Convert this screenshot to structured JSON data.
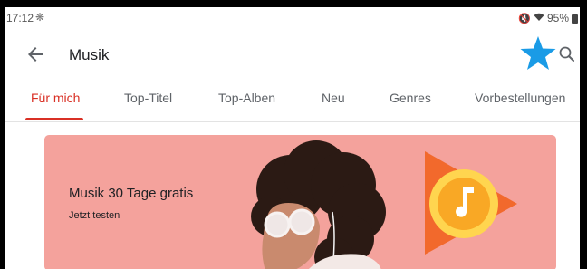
{
  "status": {
    "time": "17:12",
    "battery": "95%"
  },
  "appbar": {
    "title": "Musik"
  },
  "tabs": [
    {
      "label": "Für mich",
      "active": true
    },
    {
      "label": "Top-Titel",
      "active": false
    },
    {
      "label": "Top-Alben",
      "active": false
    },
    {
      "label": "Neu",
      "active": false
    },
    {
      "label": "Genres",
      "active": false
    },
    {
      "label": "Vorbestellungen",
      "active": false
    }
  ],
  "promo": {
    "title": "Musik 30 Tage gratis",
    "subtitle": "Jetzt testen"
  },
  "colors": {
    "accent": "#d93025",
    "promo_background": "#f4a29c",
    "star": "#1a9be6",
    "play_orange": "#f2692c",
    "play_yellow": "#fbc02d"
  },
  "icons": [
    "gear-icon",
    "mute-icon",
    "wifi-icon",
    "battery-icon",
    "back-arrow-icon",
    "star-icon",
    "search-icon",
    "music-note-icon",
    "play-music-logo"
  ]
}
